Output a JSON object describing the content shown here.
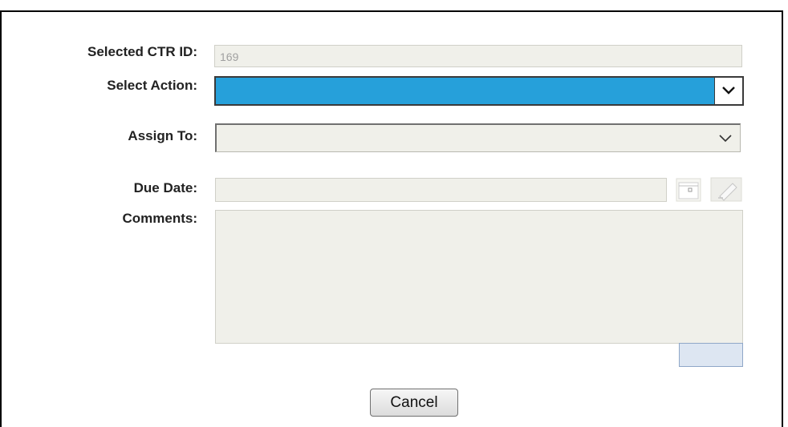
{
  "form": {
    "ctr_id": {
      "label": "Selected CTR ID:",
      "value": "169"
    },
    "action": {
      "label": "Select Action:",
      "value": ""
    },
    "assign_to": {
      "label": "Assign To:",
      "value": ""
    },
    "due_date": {
      "label": "Due Date:",
      "value": ""
    },
    "comments": {
      "label": "Comments:",
      "value": ""
    }
  },
  "buttons": {
    "cancel_label": "Cancel"
  },
  "colors": {
    "selection_highlight": "#26a0da",
    "field_background": "#f0f0ea"
  },
  "icons": {
    "calendar": "calendar-icon",
    "clear": "pencil-eraser-icon",
    "dropdown": "chevron-down-icon"
  }
}
